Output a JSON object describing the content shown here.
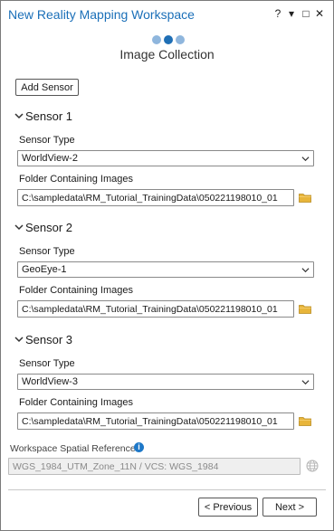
{
  "window": {
    "title": "New Reality Mapping Workspace",
    "controls": {
      "help": "?",
      "menu": "▾",
      "maximize": "□",
      "close": "✕"
    }
  },
  "wizard": {
    "step_title": "Image Collection",
    "steps_total": 3,
    "current_step": 2,
    "colors": {
      "active": "#1f6fb5",
      "inactive": "#8fb6dd"
    }
  },
  "toolbar": {
    "add_sensor_label": "Add Sensor"
  },
  "sensors": [
    {
      "title": "Sensor 1",
      "type_label": "Sensor Type",
      "type_value": "WorldView-2",
      "folder_label": "Folder Containing Images",
      "folder_value": "C:\\sampledata\\RM_Tutorial_TrainingData\\050221198010_01"
    },
    {
      "title": "Sensor 2",
      "type_label": "Sensor Type",
      "type_value": "GeoEye-1",
      "folder_label": "Folder Containing Images",
      "folder_value": "C:\\sampledata\\RM_Tutorial_TrainingData\\050221198010_01"
    },
    {
      "title": "Sensor 3",
      "type_label": "Sensor Type",
      "type_value": "WorldView-3",
      "folder_label": "Folder Containing Images",
      "folder_value": "C:\\sampledata\\RM_Tutorial_TrainingData\\050221198010_01"
    }
  ],
  "spatial_reference": {
    "label": "Workspace Spatial Reference",
    "value": "WGS_1984_UTM_Zone_11N / VCS: WGS_1984",
    "info_glyph": "i"
  },
  "footer": {
    "previous_label": "< Previous",
    "next_label": "Next >"
  },
  "colors": {
    "title": "#1a6fb8",
    "folder_icon": "#e8b53a",
    "info_icon": "#1e78c8"
  },
  "icons": [
    "help-icon",
    "menu-icon",
    "maximize-icon",
    "close-icon",
    "chevron-down-icon",
    "folder-icon",
    "info-icon",
    "globe-icon"
  ]
}
